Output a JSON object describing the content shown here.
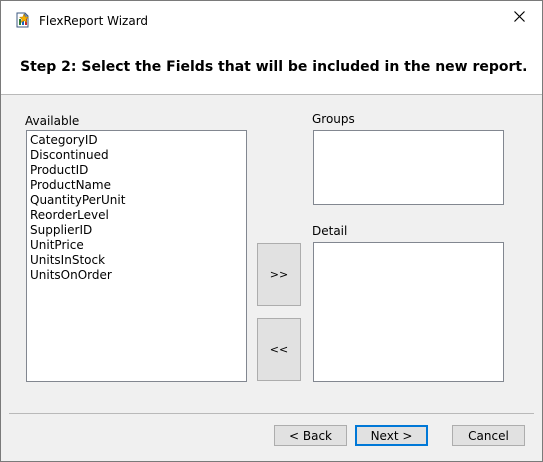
{
  "window": {
    "title": "FlexReport Wizard"
  },
  "header": {
    "step_title": "Step 2: Select the Fields that will be included in the new report."
  },
  "available": {
    "label": "Available",
    "items": [
      "CategoryID",
      "Discontinued",
      "ProductID",
      "ProductName",
      "QuantityPerUnit",
      "ReorderLevel",
      "SupplierID",
      "UnitPrice",
      "UnitsInStock",
      "UnitsOnOrder"
    ]
  },
  "groups": {
    "label": "Groups",
    "items": []
  },
  "detail": {
    "label": "Detail",
    "items": []
  },
  "buttons": {
    "add": ">>",
    "remove": "<<",
    "back": "< Back",
    "next": "Next >",
    "cancel": "Cancel"
  },
  "icons": {
    "app": "report-wizard-icon",
    "close": "close-icon"
  },
  "colors": {
    "accent": "#0078d7",
    "window_bg": "#f0f0f0",
    "button_bg": "#e1e1e1"
  }
}
